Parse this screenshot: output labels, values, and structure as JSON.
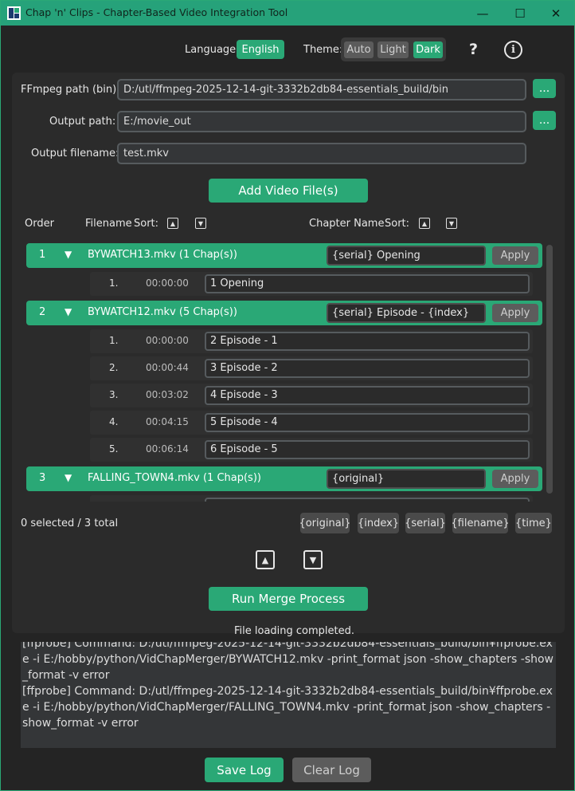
{
  "window": {
    "title": "Chap 'n' Clips - Chapter-Based Video Integration Tool",
    "minimize_glyph": "—",
    "maximize_glyph": "☐",
    "close_glyph": "✕"
  },
  "topbar": {
    "language_label": "Language:",
    "language_value": "English",
    "theme_label": "Theme:",
    "theme_options": [
      "Auto",
      "Light",
      "Dark"
    ],
    "theme_selected": "Dark",
    "help_glyph": "?",
    "info_glyph": "i"
  },
  "paths": {
    "ffmpeg_label": "FFmpeg path (bin):",
    "ffmpeg_value": "D:/utl/ffmpeg-2025-12-14-git-3332b2db84-essentials_build/bin",
    "output_label": "Output path:",
    "output_value": "E:/movie_out",
    "filename_label": "Output filename:",
    "filename_value": "test.mkv",
    "browse_label": "..."
  },
  "add_button": "Add Video File(s)",
  "columns": {
    "order": "Order",
    "filename": "Filename",
    "sort": "Sort:",
    "chapter_name": "Chapter Name",
    "sort2": "Sort:"
  },
  "groups": [
    {
      "order": "1",
      "name": "BYWATCH13.mkv (1 Chap(s))",
      "template": "{serial} Opening",
      "apply": "Apply",
      "chapters": [
        {
          "num": "1.",
          "time": "00:00:00",
          "name": "1 Opening"
        }
      ]
    },
    {
      "order": "2",
      "name": "BYWATCH12.mkv (5 Chap(s))",
      "template": "{serial} Episode - {index}",
      "apply": "Apply",
      "chapters": [
        {
          "num": "1.",
          "time": "00:00:00",
          "name": "2 Episode - 1"
        },
        {
          "num": "2.",
          "time": "00:00:44",
          "name": "3 Episode - 2"
        },
        {
          "num": "3.",
          "time": "00:03:02",
          "name": "4 Episode - 3"
        },
        {
          "num": "4.",
          "time": "00:04:15",
          "name": "5 Episode - 4"
        },
        {
          "num": "5.",
          "time": "00:06:14",
          "name": "6 Episode - 5"
        }
      ]
    },
    {
      "order": "3",
      "name": "FALLING_TOWN4.mkv (1 Chap(s))",
      "template": "{original}",
      "apply": "Apply",
      "chapters": []
    }
  ],
  "selection_status": "0 selected / 3 total",
  "tokens": [
    "{original}",
    "{index}",
    "{serial}",
    "{filename}",
    "{time}"
  ],
  "run_button": "Run Merge Process",
  "status": "File loading completed.",
  "log_lines": [
    "[ffprobe] Command: D:/utl/ffmpeg-2025-12-14-git-3332b2db84-essentials_build/bin¥ffprobe.exe -i E:/hobby/python/VidChapMerger/BYWATCH12.mkv -print_format json -show_chapters -show_format -v error",
    "[ffprobe] Command: D:/utl/ffmpeg-2025-12-14-git-3332b2db84-essentials_build/bin¥ffprobe.exe -i E:/hobby/python/VidChapMerger/FALLING_TOWN4.mkv -print_format json -show_chapters -show_format -v error"
  ],
  "save_log": "Save Log",
  "clear_log": "Clear Log",
  "colors": {
    "accent": "#2aa876",
    "background": "#242424",
    "panel": "#2b2b2b",
    "disabled_button": "#5c5c5c"
  }
}
